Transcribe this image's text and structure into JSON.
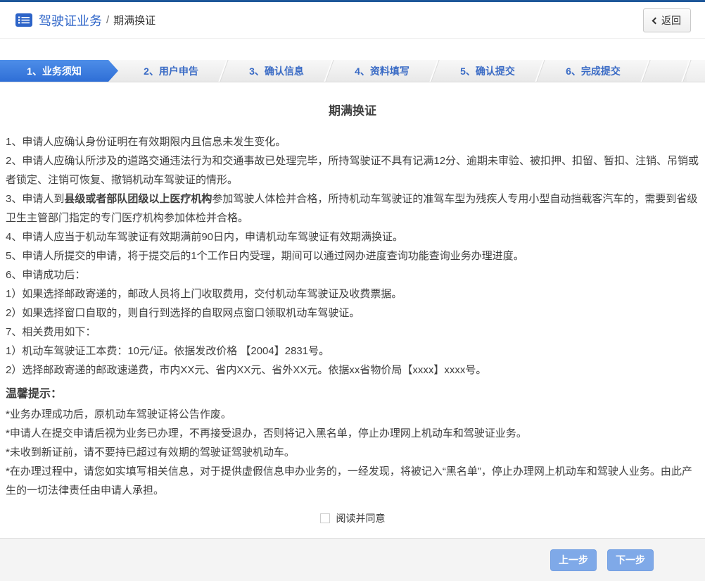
{
  "colors": {
    "top_bar": "#1e5799",
    "accent_blue": "#2e6ed6",
    "step_text_blue": "#3a6bc5",
    "header_title_blue": "#2d64c8",
    "action_button_blue": "#7fa9e8",
    "body_text": "#3f3f3f"
  },
  "header": {
    "title": "驾驶证业务",
    "separator": "/",
    "subtitle": "期满换证",
    "back_label": "返回"
  },
  "steps": [
    "1、业务须知",
    "2、用户申告",
    "3、确认信息",
    "4、资料填写",
    "5、确认提交",
    "6、完成提交"
  ],
  "content": {
    "title": "期满换证",
    "notices": [
      "1、申请人应确认身份证明在有效期限内且信息未发生变化。",
      "2、申请人应确认所涉及的道路交通违法行为和交通事故已处理完毕，所持驾驶证不具有记满12分、逾期未审验、被扣押、扣留、暂扣、注销、吊销或者锁定、注销可恢复、撤销机动车驾驶证的情形。",
      {
        "prefix": "3、申请人到",
        "bold": "县级或者部队团级以上医疗机构",
        "suffix": "参加驾驶人体检并合格，所持机动车驾驶证的准驾车型为残疾人专用小型自动挡载客汽车的，需要到省级卫生主管部门指定的专门医疗机构参加体检并合格。"
      },
      "4、申请人应当于机动车驾驶证有效期满前90日内，申请机动车驾驶证有效期满换证。",
      "5、申请人所提交的申请，将于提交后的1个工作日内受理，期间可以通过网办进度查询功能查询业务办理进度。",
      "6、申请成功后：",
      "1）如果选择邮政寄递的，邮政人员将上门收取费用，交付机动车驾驶证及收费票据。",
      "2）如果选择窗口自取的，则自行到选择的自取网点窗口领取机动车驾驶证。",
      "7、相关费用如下：",
      "1）机动车驾驶证工本费：10元/证。依据发改价格 【2004】2831号。",
      "2）选择邮政寄递的邮政速递费，市内XX元、省内XX元、省外XX元。依据xx省物价局【xxxx】xxxx号。"
    ],
    "tips_title": "温馨提示：",
    "tips": [
      "*业务办理成功后，原机动车驾驶证将公告作废。",
      "*申请人在提交申请后视为业务已办理，不再接受退办，否则将记入黑名单，停止办理网上机动车和驾驶证业务。",
      "*未收到新证前，请不要持已超过有效期的驾驶证驾驶机动车。",
      "*在办理过程中，请您如实填写相关信息，对于提供虚假信息申办业务的，一经发现，将被记入“黑名单”，停止办理网上机动车和驾驶人业务。由此产生的一切法律责任由申请人承担。"
    ]
  },
  "agreement": {
    "checkbox_label": "阅读并同意"
  },
  "footer": {
    "prev_label": "上一步",
    "next_label": "下一步"
  }
}
